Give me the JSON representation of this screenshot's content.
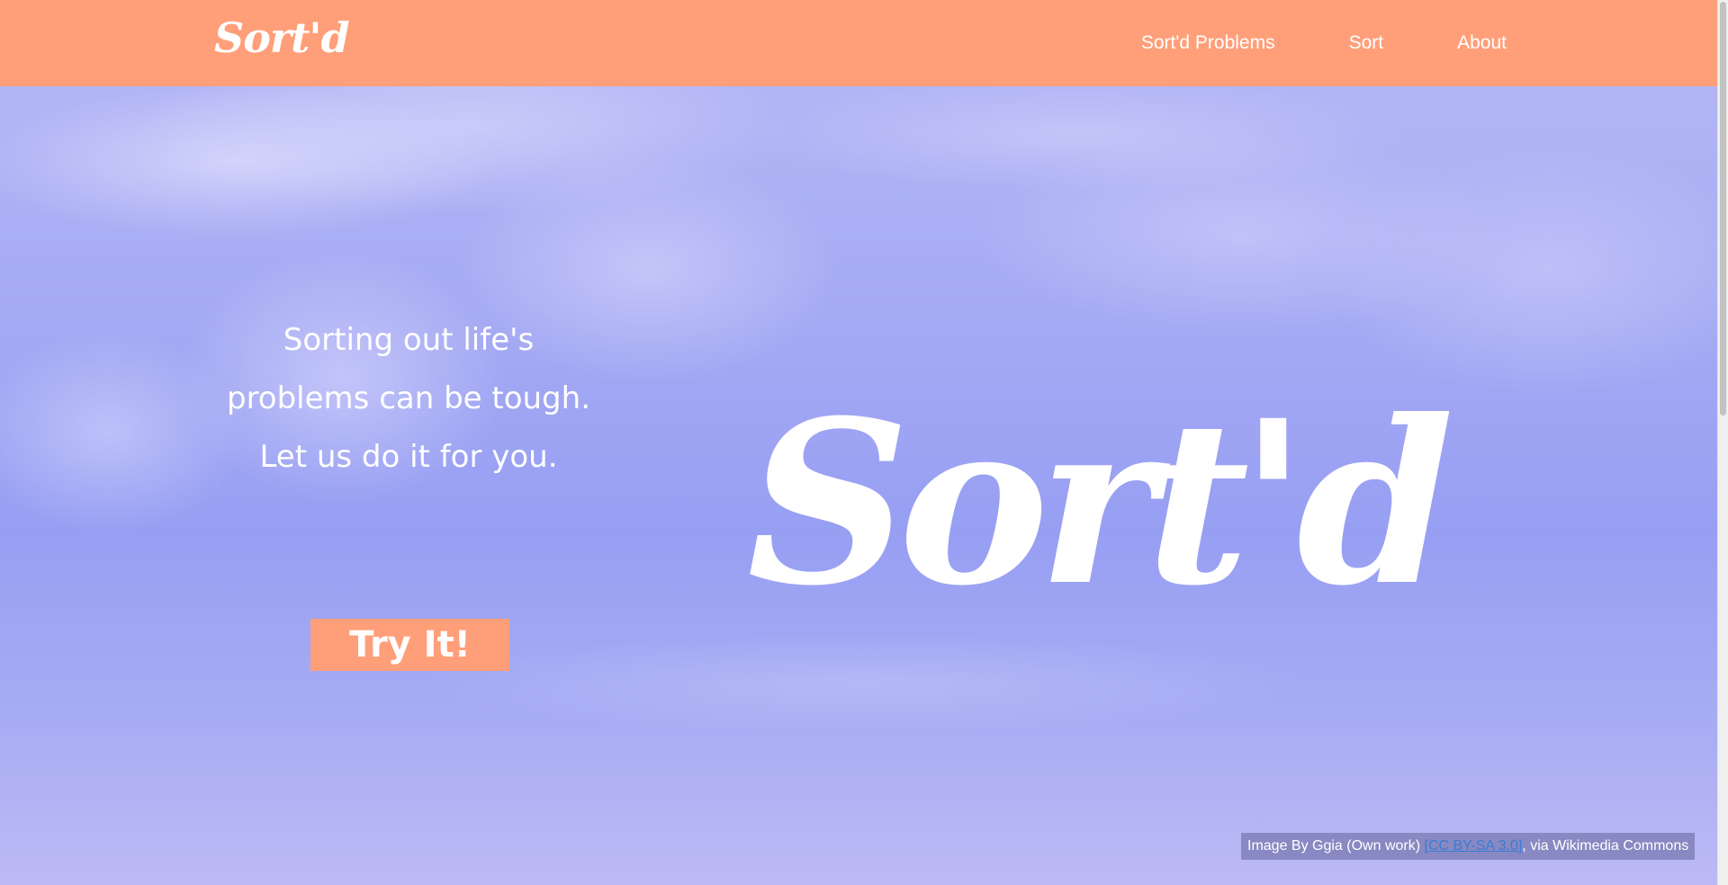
{
  "nav": {
    "brand": "Sort'd",
    "links": [
      "Sort'd Problems",
      "Sort",
      "About"
    ]
  },
  "hero": {
    "tagline": [
      "Sorting out life's",
      "problems can be tough.",
      "Let us do it for you."
    ],
    "button_label": "Try It!",
    "logo_text": "Sort'd"
  },
  "credit": {
    "prefix": "Image By Ggia (Own work) ",
    "license_link": "[CC BY-SA 3.0]",
    "suffix": ", via Wikimedia Commons"
  },
  "colors": {
    "accent": "#ff9f7a",
    "sky": "#a6aaf3",
    "link": "#3a7bd5"
  }
}
